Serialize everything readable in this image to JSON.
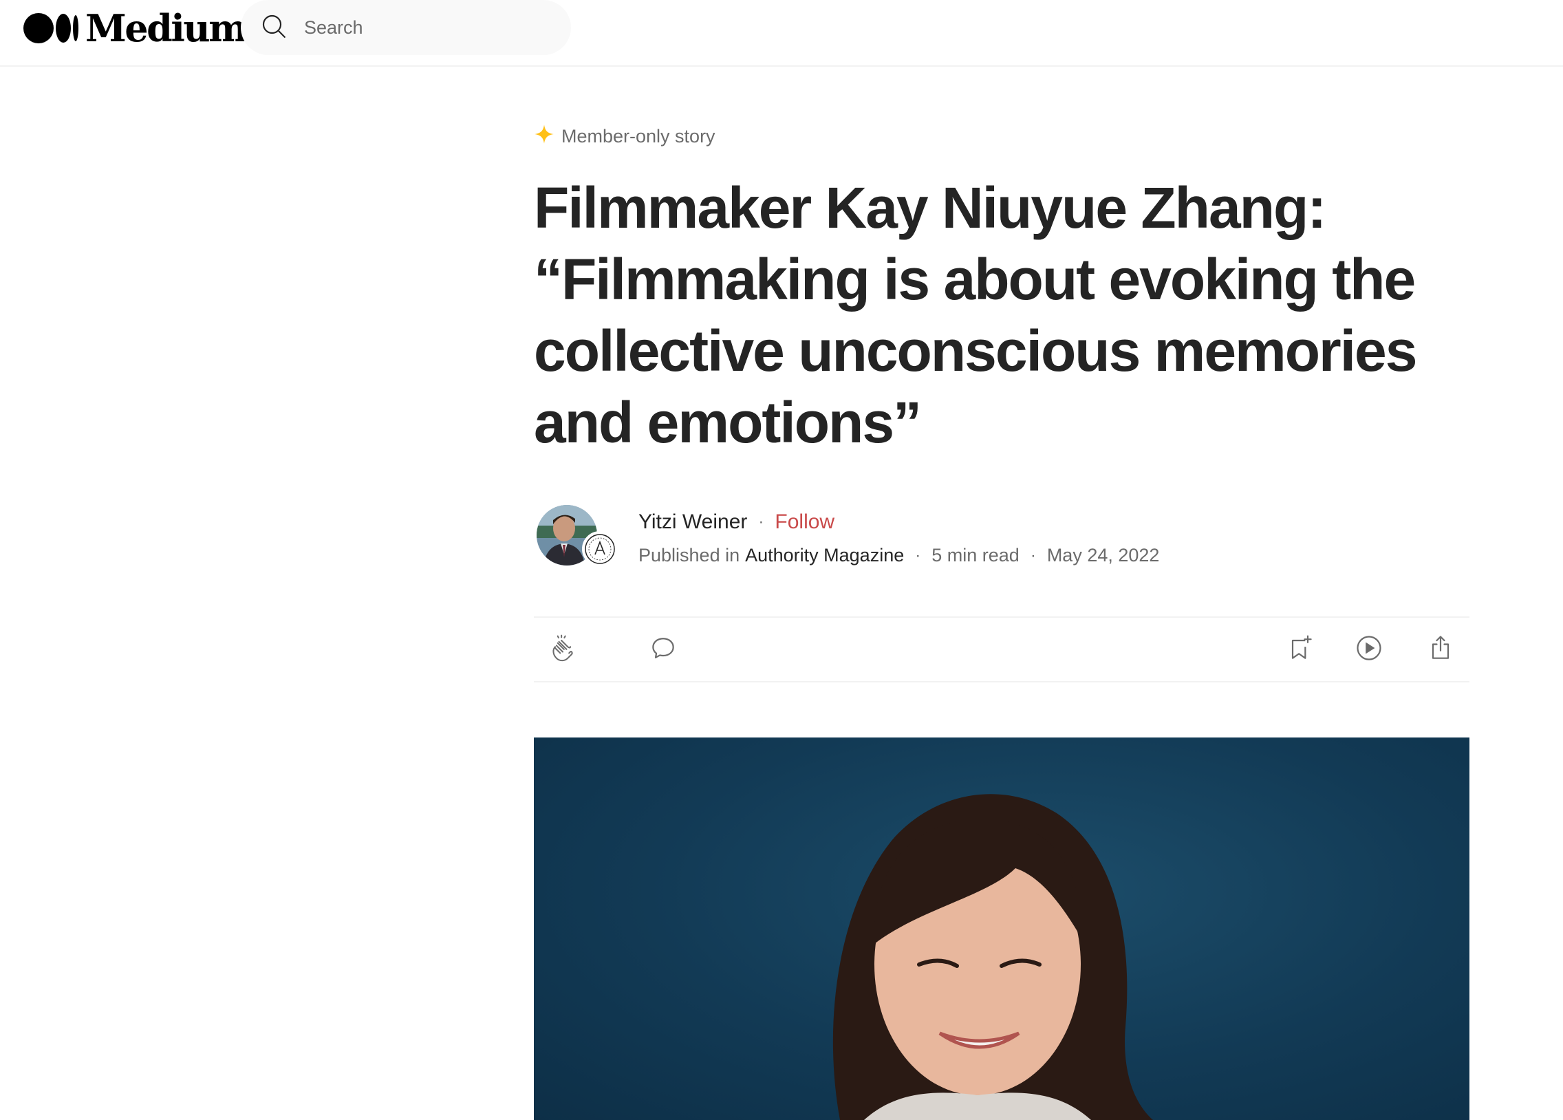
{
  "header": {
    "brand": "Medium",
    "search": {
      "placeholder": "Search"
    }
  },
  "article": {
    "badge_label": "Member-only story",
    "title": "Filmmaker Kay Niuyue Zhang: “Filmmaking is about evoking the collective unconscious memories and emotions”",
    "author": {
      "name": "Yitzi Weiner",
      "follow_label": "Follow",
      "published_in_label": "Published in",
      "publication": "Authority Magazine",
      "read_time": "5 min read",
      "date": "May 24, 2022"
    },
    "actions": {
      "clap": "clap-icon",
      "comment": "comment-icon",
      "save": "bookmark-add-icon",
      "listen": "play-icon",
      "share": "share-icon"
    }
  },
  "colors": {
    "accent_follow": "#c94a4a",
    "member_star": "#ffc017",
    "text_primary": "#242424",
    "text_secondary": "#6b6b6b",
    "hero_background": "#123a55"
  }
}
